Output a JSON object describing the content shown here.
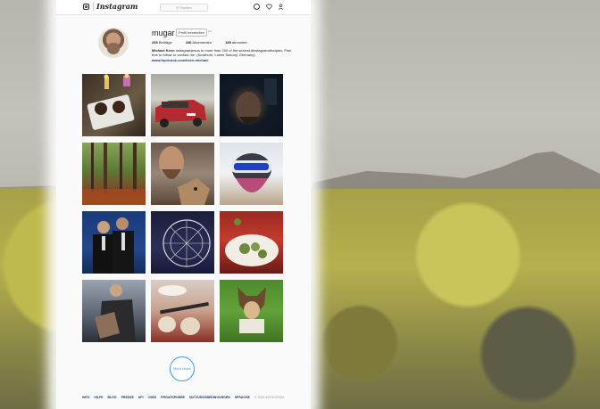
{
  "header": {
    "brand": "Instagram",
    "search_placeholder": "Suchen",
    "icons": [
      "instagram-icon",
      "search-icon",
      "compass-icon",
      "heart-icon",
      "person-icon"
    ]
  },
  "profile": {
    "username": "mugar",
    "edit_label": "Profil bearbeiten",
    "more": "•••",
    "stats": [
      {
        "count": "295",
        "label": "Beiträge"
      },
      {
        "count": "236",
        "label": "Abonnenten"
      },
      {
        "count": "189",
        "label": "abonniert"
      }
    ],
    "bio_name": "Michael Keen",
    "bio_text": "Instagramjesus to more than 200 of the sexiest #instagramdisciples. Feel free to follow or contact me. (Nordhorn, Lower Saxony, Germany)",
    "link": "www.facebook.com/keen.michael"
  },
  "posts": [
    {
      "subject": "desserts-on-table"
    },
    {
      "subject": "red-car"
    },
    {
      "subject": "dark-portrait"
    },
    {
      "subject": "forest"
    },
    {
      "subject": "man-with-dog"
    },
    {
      "subject": "vr-headset"
    },
    {
      "subject": "two-men-suits"
    },
    {
      "subject": "ferris-wheel"
    },
    {
      "subject": "food-plate"
    },
    {
      "subject": "man-holding-dog"
    },
    {
      "subject": "bread-and-knife"
    },
    {
      "subject": "dog-on-grass"
    }
  ],
  "load_more": "Mehr laden",
  "footer": {
    "links": [
      "INFO",
      "HILFE",
      "BLOG",
      "PRESSE",
      "API",
      "JOBS",
      "PRIVATSPHÄRE",
      "NUTZUNGSBEDINGUNGEN",
      "SPRACHE"
    ],
    "copyright": "© 2016 INSTAGRAM"
  }
}
